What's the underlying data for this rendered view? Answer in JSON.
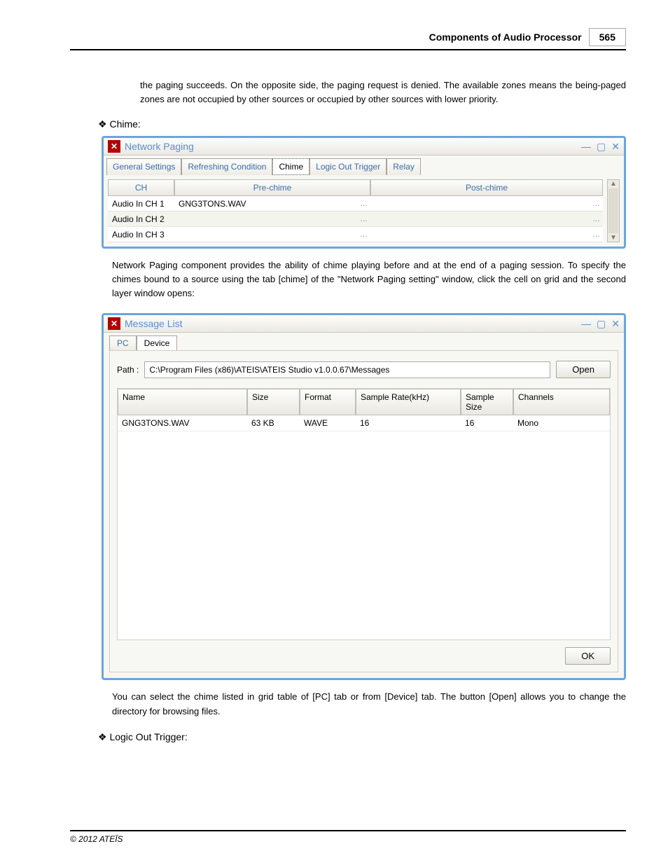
{
  "header": {
    "title": "Components of Audio Processor",
    "page": "565"
  },
  "para1": "the paging succeeds. On the opposite side, the paging request is denied. The available zones means the being-paged zones are not occupied by other sources or occupied by other sources with lower priority.",
  "bullet_chime": "Chime:",
  "win1": {
    "title": "Network Paging",
    "tabs": [
      "General Settings",
      "Refreshing Condition",
      "Chime",
      "Logic Out Trigger",
      "Relay"
    ],
    "active_tab": 2,
    "cols": {
      "ch": "CH",
      "pre": "Pre-chime",
      "post": "Post-chime"
    },
    "rows": [
      {
        "ch": "Audio In CH 1",
        "pre": "GNG3TONS.WAV",
        "post": ""
      },
      {
        "ch": "Audio In CH 2",
        "pre": "",
        "post": ""
      },
      {
        "ch": "Audio In CH 3",
        "pre": "",
        "post": ""
      }
    ]
  },
  "para2": "Network Paging component provides the ability of chime playing before and at the end of a paging session. To specify the chimes bound to a source using the tab [chime] of the \"Network Paging setting\" window, click the cell on grid and the second layer window opens:",
  "win2": {
    "title": "Message List",
    "tabs": [
      "PC",
      "Device"
    ],
    "active_tab": 1,
    "path_label": "Path :",
    "path_value": "C:\\Program Files (x86)\\ATEIS\\ATEIS Studio v1.0.0.67\\Messages",
    "open_btn": "Open",
    "cols": {
      "name": "Name",
      "size": "Size",
      "fmt": "Format",
      "sr": "Sample Rate(kHz)",
      "ss": "Sample Size",
      "chn": "Channels"
    },
    "rows": [
      {
        "name": "GNG3TONS.WAV",
        "size": "63 KB",
        "fmt": "WAVE",
        "sr": "16",
        "ss": "16",
        "chn": "Mono"
      }
    ],
    "ok_btn": "OK"
  },
  "para3": "You can select the chime listed in grid table of [PC] tab or from [Device] tab. The button [Open] allows you to change the directory for browsing files.",
  "bullet_logic": "Logic Out Trigger:",
  "footer": "© 2012 ATEÏS"
}
